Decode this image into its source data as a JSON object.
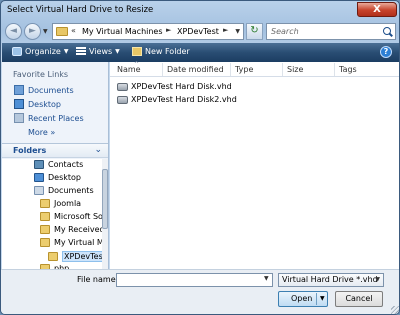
{
  "window": {
    "title": "Select Virtual Hard Drive to Resize",
    "close_glyph": "X"
  },
  "nav": {
    "back_glyph": "◄",
    "forward_glyph": "►"
  },
  "address": {
    "chevron": "«",
    "segments": [
      "My Virtual Machines",
      "XPDevTest"
    ],
    "separator": "►"
  },
  "search": {
    "placeholder": "Search"
  },
  "toolbar": {
    "organize_label": "Organize",
    "views_label": "Views",
    "new_folder_label": "New Folder"
  },
  "favorites": {
    "title": "Favorite Links",
    "items": [
      "Documents",
      "Desktop",
      "Recent Places"
    ],
    "more_label": "More",
    "more_glyph": "»"
  },
  "folders": {
    "label": "Folders",
    "tree": [
      "Contacts",
      "Desktop",
      "Documents",
      "Joomla",
      "Microsoft So",
      "My Received",
      "My Virtual M",
      "XPDevTest",
      "php"
    ],
    "selected_index": 7
  },
  "columns": [
    "Name",
    "Date modified",
    "Type",
    "Size",
    "Tags"
  ],
  "files": [
    "XPDevTest Hard Disk.vhd",
    "XPDevTest Hard Disk2.vhd"
  ],
  "footer": {
    "file_name_label": "File name:",
    "file_name_value": "",
    "file_type_value": "Virtual Hard Drive *.vhd",
    "open_label": "Open",
    "cancel_label": "Cancel"
  },
  "colors": {
    "toolbar": "#294d73",
    "link": "#1d4e91",
    "close": "#c7432b"
  },
  "icons": [
    "close-icon",
    "back-icon",
    "forward-icon",
    "folder-icon",
    "refresh-icon",
    "search-icon",
    "organize-icon",
    "views-icon",
    "new-folder-icon",
    "help-icon",
    "documents-icon",
    "desktop-icon",
    "recent-places-icon",
    "contacts-icon",
    "vhd-file-icon"
  ]
}
